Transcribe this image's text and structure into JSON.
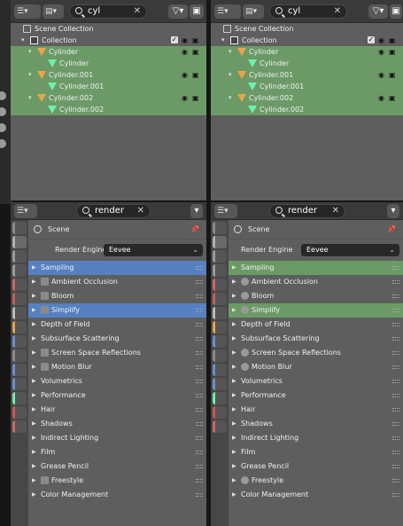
{
  "outliners": [
    {
      "search_value": "cyl",
      "tree": [
        {
          "label": "Scene Collection",
          "icon": "scene-collection-icon",
          "indent": 0,
          "highlight": false,
          "arrow": "",
          "checkbox": false
        },
        {
          "label": "Collection",
          "icon": "collection-icon",
          "indent": 1,
          "highlight": false,
          "arrow": "▾",
          "checkbox": true
        },
        {
          "label": "Cylinder",
          "icon": "object-icon",
          "indent": 2,
          "highlight": true,
          "arrow": "▾",
          "checkbox": false
        },
        {
          "label": "Cylinder",
          "icon": "mesh-icon",
          "indent": 3,
          "highlight": true,
          "arrow": "",
          "checkbox": false
        },
        {
          "label": "Cylinder.001",
          "icon": "object-icon",
          "indent": 2,
          "highlight": true,
          "arrow": "▾",
          "checkbox": false
        },
        {
          "label": "Cylinder.001",
          "icon": "mesh-icon",
          "indent": 3,
          "highlight": true,
          "arrow": "",
          "checkbox": false
        },
        {
          "label": "Cylinder.002",
          "icon": "object-icon",
          "indent": 2,
          "highlight": true,
          "arrow": "▾",
          "checkbox": false
        },
        {
          "label": "Cylinder.002",
          "icon": "mesh-icon",
          "indent": 3,
          "highlight": true,
          "arrow": "",
          "checkbox": false
        }
      ]
    },
    {
      "search_value": "cyl",
      "tree": [
        {
          "label": "Scene Collection",
          "icon": "scene-collection-icon",
          "indent": 0,
          "highlight": false,
          "arrow": "",
          "checkbox": false
        },
        {
          "label": "Collection",
          "icon": "collection-icon",
          "indent": 1,
          "highlight": false,
          "arrow": "▾",
          "checkbox": true
        },
        {
          "label": "Cylinder",
          "icon": "object-icon",
          "indent": 2,
          "highlight": true,
          "arrow": "▾",
          "checkbox": false
        },
        {
          "label": "Cylinder",
          "icon": "mesh-icon",
          "indent": 3,
          "highlight": true,
          "arrow": "",
          "checkbox": false
        },
        {
          "label": "Cylinder.001",
          "icon": "object-icon",
          "indent": 2,
          "highlight": true,
          "arrow": "▾",
          "checkbox": false
        },
        {
          "label": "Cylinder.001",
          "icon": "mesh-icon",
          "indent": 3,
          "highlight": true,
          "arrow": "",
          "checkbox": false
        },
        {
          "label": "Cylinder.002",
          "icon": "object-icon",
          "indent": 2,
          "highlight": true,
          "arrow": "▾",
          "checkbox": false
        },
        {
          "label": "Cylinder.002",
          "icon": "mesh-icon",
          "indent": 3,
          "highlight": true,
          "arrow": "",
          "checkbox": false
        }
      ]
    }
  ],
  "properties": [
    {
      "search_value": "render",
      "context": "Scene",
      "engine_label": "Render Engine",
      "engine_value": "Eevee",
      "highlight_color": "#5680c2",
      "panels": [
        {
          "label": "Sampling",
          "checkbox": false,
          "highlight": true
        },
        {
          "label": "Ambient Occlusion",
          "checkbox": true,
          "highlight": false
        },
        {
          "label": "Bloom",
          "checkbox": true,
          "highlight": false
        },
        {
          "label": "Simplify",
          "checkbox": true,
          "highlight": true
        },
        {
          "label": "Depth of Field",
          "checkbox": false,
          "highlight": false
        },
        {
          "label": "Subsurface Scattering",
          "checkbox": false,
          "highlight": false
        },
        {
          "label": "Screen Space Reflections",
          "checkbox": true,
          "highlight": false
        },
        {
          "label": "Motion Blur",
          "checkbox": true,
          "highlight": false
        },
        {
          "label": "Volumetrics",
          "checkbox": false,
          "highlight": false
        },
        {
          "label": "Performance",
          "checkbox": false,
          "highlight": false
        },
        {
          "label": "Hair",
          "checkbox": false,
          "highlight": false
        },
        {
          "label": "Shadows",
          "checkbox": false,
          "highlight": false
        },
        {
          "label": "Indirect Lighting",
          "checkbox": false,
          "highlight": false
        },
        {
          "label": "Film",
          "checkbox": false,
          "highlight": false
        },
        {
          "label": "Grease Pencil",
          "checkbox": false,
          "highlight": false
        },
        {
          "label": "Freestyle",
          "checkbox": true,
          "highlight": false
        },
        {
          "label": "Color Management",
          "checkbox": false,
          "highlight": false
        }
      ]
    },
    {
      "search_value": "render",
      "context": "Scene",
      "engine_label": "Render Engine",
      "engine_value": "Eevee",
      "highlight_color": "#6c9a67",
      "panels": [
        {
          "label": "Sampling",
          "checkbox": false,
          "highlight": true
        },
        {
          "label": "Ambient Occlusion",
          "checkbox": true,
          "highlight": false
        },
        {
          "label": "Bloom",
          "checkbox": true,
          "highlight": false
        },
        {
          "label": "Simplify",
          "checkbox": true,
          "highlight": true
        },
        {
          "label": "Depth of Field",
          "checkbox": false,
          "highlight": false
        },
        {
          "label": "Subsurface Scattering",
          "checkbox": false,
          "highlight": false
        },
        {
          "label": "Screen Space Reflections",
          "checkbox": true,
          "highlight": false
        },
        {
          "label": "Motion Blur",
          "checkbox": true,
          "highlight": false
        },
        {
          "label": "Volumetrics",
          "checkbox": false,
          "highlight": false
        },
        {
          "label": "Performance",
          "checkbox": false,
          "highlight": false
        },
        {
          "label": "Hair",
          "checkbox": false,
          "highlight": false
        },
        {
          "label": "Shadows",
          "checkbox": false,
          "highlight": false
        },
        {
          "label": "Indirect Lighting",
          "checkbox": false,
          "highlight": false
        },
        {
          "label": "Film",
          "checkbox": false,
          "highlight": false
        },
        {
          "label": "Grease Pencil",
          "checkbox": false,
          "highlight": false
        },
        {
          "label": "Freestyle",
          "checkbox": true,
          "highlight": false
        },
        {
          "label": "Color Management",
          "checkbox": false,
          "highlight": false
        }
      ]
    }
  ]
}
